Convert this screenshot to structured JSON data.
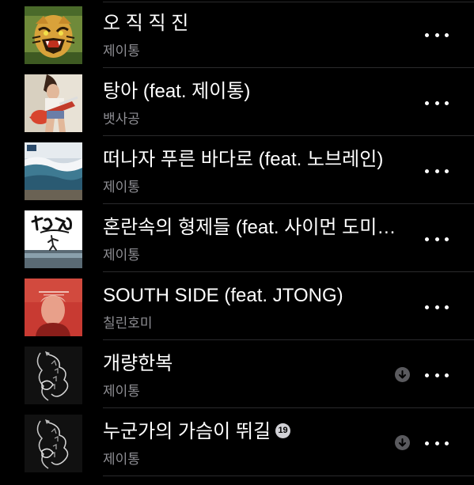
{
  "tracks": [
    {
      "title": "오 직 직 진",
      "artist": "제이통",
      "art_icon": "tiger-album-art",
      "downloaded": false
    },
    {
      "title": "탕아 (feat. 제이통)",
      "artist": "뱃사공",
      "art_icon": "guitar-girl-album-art",
      "downloaded": false
    },
    {
      "title": "떠나자 푸른 바다로 (feat. 노브레인)",
      "artist": "제이통",
      "art_icon": "ocean-wave-album-art",
      "downloaded": false
    },
    {
      "title": "혼란속의 형제들 (feat. 사이먼 도미…",
      "artist": "제이통",
      "art_icon": "calligraphy-sky-album-art",
      "downloaded": false
    },
    {
      "title": "SOUTH SIDE (feat. JTONG)",
      "artist": "칠린호미",
      "art_icon": "red-portrait-album-art",
      "downloaded": false
    },
    {
      "title": "개량한복",
      "artist": "제이통",
      "art_icon": "dragon-fish-album-art",
      "downloaded": true
    },
    {
      "title": "누군가의 가슴이 뛰길",
      "artist": "제이통",
      "art_icon": "dragon-fish-album-art",
      "downloaded": true,
      "explicit_badge": "19"
    }
  ],
  "colors": {
    "background": "#000000",
    "title_text": "#ffffff",
    "artist_text": "#8e8e93",
    "separator": "#2a2a2c",
    "download_badge": "#5a5a5e"
  },
  "icons": {
    "more": "ellipsis-icon",
    "download": "download-arrow-icon"
  }
}
